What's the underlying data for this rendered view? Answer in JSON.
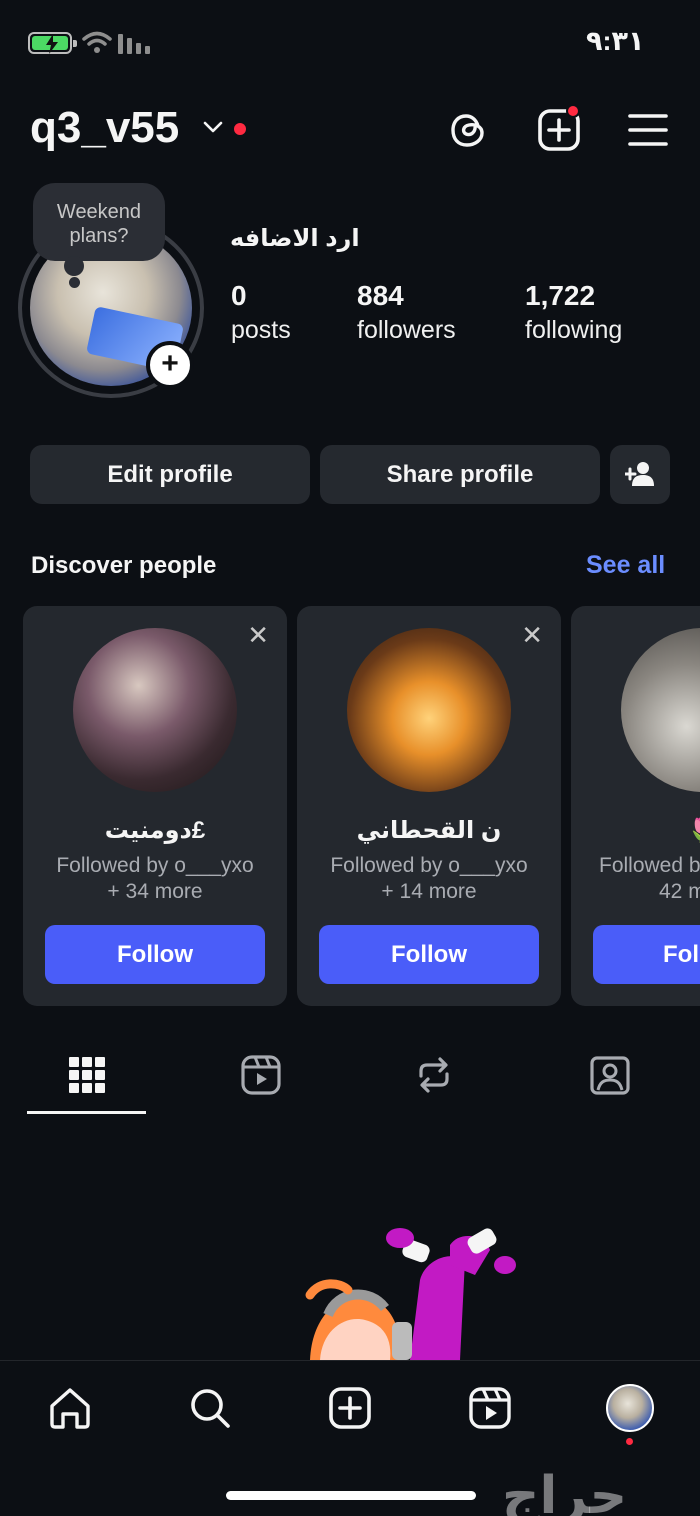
{
  "status_bar": {
    "time": "٩:٣١",
    "battery_color": "#4cd964"
  },
  "header": {
    "username": "q3_v55",
    "icons": [
      "chevron-down-icon",
      "threads-icon",
      "create-icon",
      "menu-icon"
    ],
    "notification_dot_color": "#ff2a41"
  },
  "profile": {
    "note": "Weekend plans?",
    "bio": "ارد الاضافه",
    "stats": [
      {
        "value": "0",
        "label": "posts"
      },
      {
        "value": "884",
        "label": "followers"
      },
      {
        "value": "1,722",
        "label": "following"
      }
    ]
  },
  "actions": {
    "edit": "Edit profile",
    "share": "Share profile",
    "add_user_icon": "add-user-icon"
  },
  "discover": {
    "title": "Discover people",
    "see_all": "See all",
    "accent": "#6b8dff",
    "cards": [
      {
        "name": "دومنيت£",
        "followed_by": "Followed by o___yxo",
        "more": "+ 34 more",
        "button": "Follow"
      },
      {
        "name": "ن القحطاني",
        "followed_by": "Followed by o___yxo",
        "more": "+ 14 more",
        "button": "Follow"
      },
      {
        "name": "🌷",
        "followed_by": "Followed b",
        "more": "42 m",
        "button": "Fol"
      }
    ],
    "follow_color": "#4a5df9"
  },
  "tabs": [
    "grid-icon",
    "reels-icon",
    "reposts-icon",
    "tagged-icon"
  ],
  "bottom_nav": [
    "home-icon",
    "search-icon",
    "create-icon",
    "reels-icon",
    "profile-avatar"
  ],
  "watermark": "حراج"
}
